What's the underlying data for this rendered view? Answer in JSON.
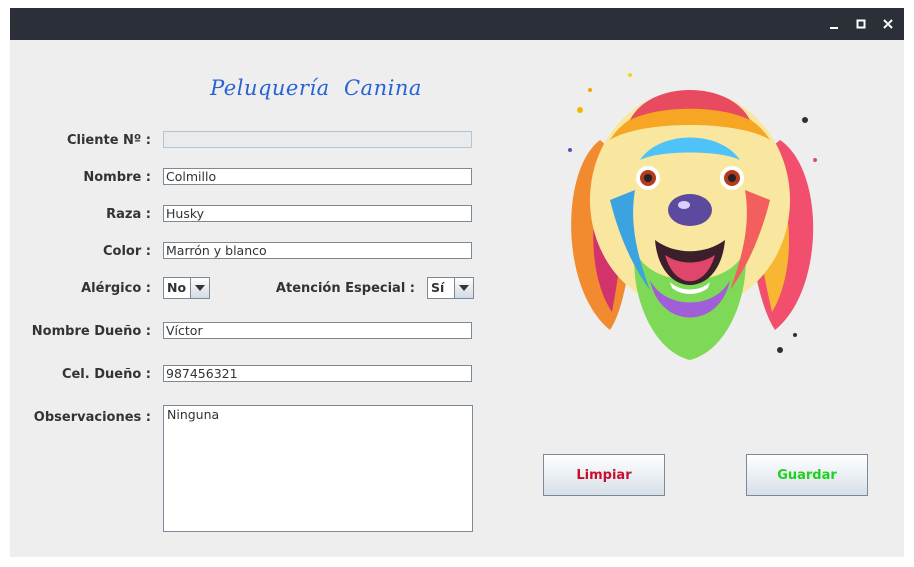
{
  "window": {
    "controls": [
      "minimize-icon",
      "maximize-icon",
      "close-icon"
    ]
  },
  "form": {
    "title": "Peluquería  Canina",
    "cliente_label": "Cliente Nº :",
    "cliente_value": "",
    "nombre_label": "Nombre :",
    "nombre_value": "Colmillo",
    "raza_label": "Raza :",
    "raza_value": "Husky",
    "color_label": "Color :",
    "color_value": "Marrón y blanco",
    "alergico_label": "Alérgico :",
    "alergico_value": "No",
    "atencion_label": "Atención Especial :",
    "atencion_value": "Sí",
    "dueno_label": "Nombre Dueño :",
    "dueno_value": "Víctor",
    "celular_label": "Cel. Dueño :",
    "celular_value": "987456321",
    "observaciones_label": "Observaciones :",
    "observaciones_value": "Ninguna"
  },
  "buttons": {
    "limpiar": "Limpiar",
    "guardar": "Guardar"
  },
  "colors": {
    "title": "#2763d6",
    "limpiar_text": "#c8102e",
    "guardar_text": "#1fd11f",
    "titlebar": "#2b2f38"
  },
  "image": {
    "subject": "colorful-watercolor-dog-illustration"
  }
}
